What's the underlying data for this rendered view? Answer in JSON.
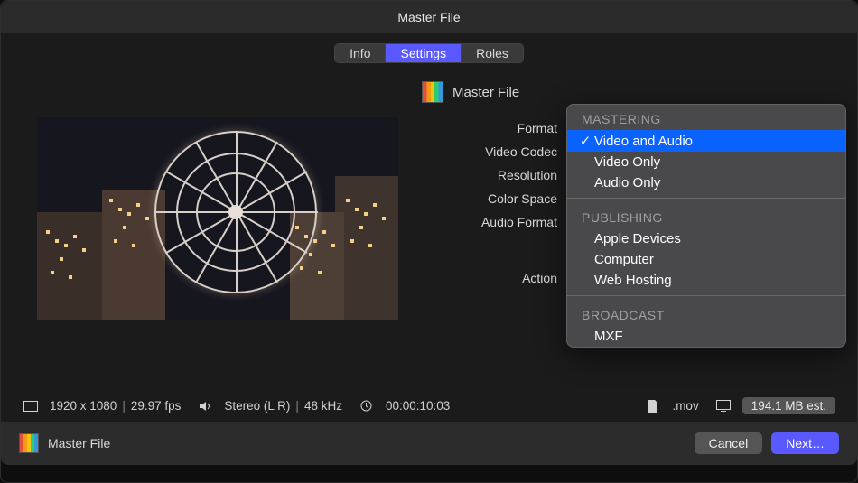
{
  "window": {
    "title": "Master File"
  },
  "tabs": {
    "info": "Info",
    "settings": "Settings",
    "roles": "Roles",
    "active": "settings"
  },
  "preset": {
    "name": "Master File"
  },
  "fields": {
    "format": "Format",
    "video_codec": "Video Codec",
    "resolution": "Resolution",
    "color_space": "Color Space",
    "audio_format": "Audio Format",
    "action": "Action"
  },
  "dropdown": {
    "sections": {
      "mastering": {
        "title": "MASTERING",
        "items": [
          "Video and Audio",
          "Video Only",
          "Audio Only"
        ],
        "selected": "Video and Audio"
      },
      "publishing": {
        "title": "PUBLISHING",
        "items": [
          "Apple Devices",
          "Computer",
          "Web Hosting"
        ]
      },
      "broadcast": {
        "title": "BROADCAST",
        "items": [
          "MXF"
        ]
      }
    }
  },
  "status": {
    "dimensions": "1920 x 1080",
    "fps": "29.97 fps",
    "audio": "Stereo (L R)",
    "sample_rate": "48 kHz",
    "duration": "00:00:10:03",
    "extension": ".mov",
    "size_est": "194.1 MB est."
  },
  "footer": {
    "preset_name": "Master File",
    "cancel": "Cancel",
    "next": "Next…"
  },
  "separator": "|",
  "checkmark": "✓"
}
